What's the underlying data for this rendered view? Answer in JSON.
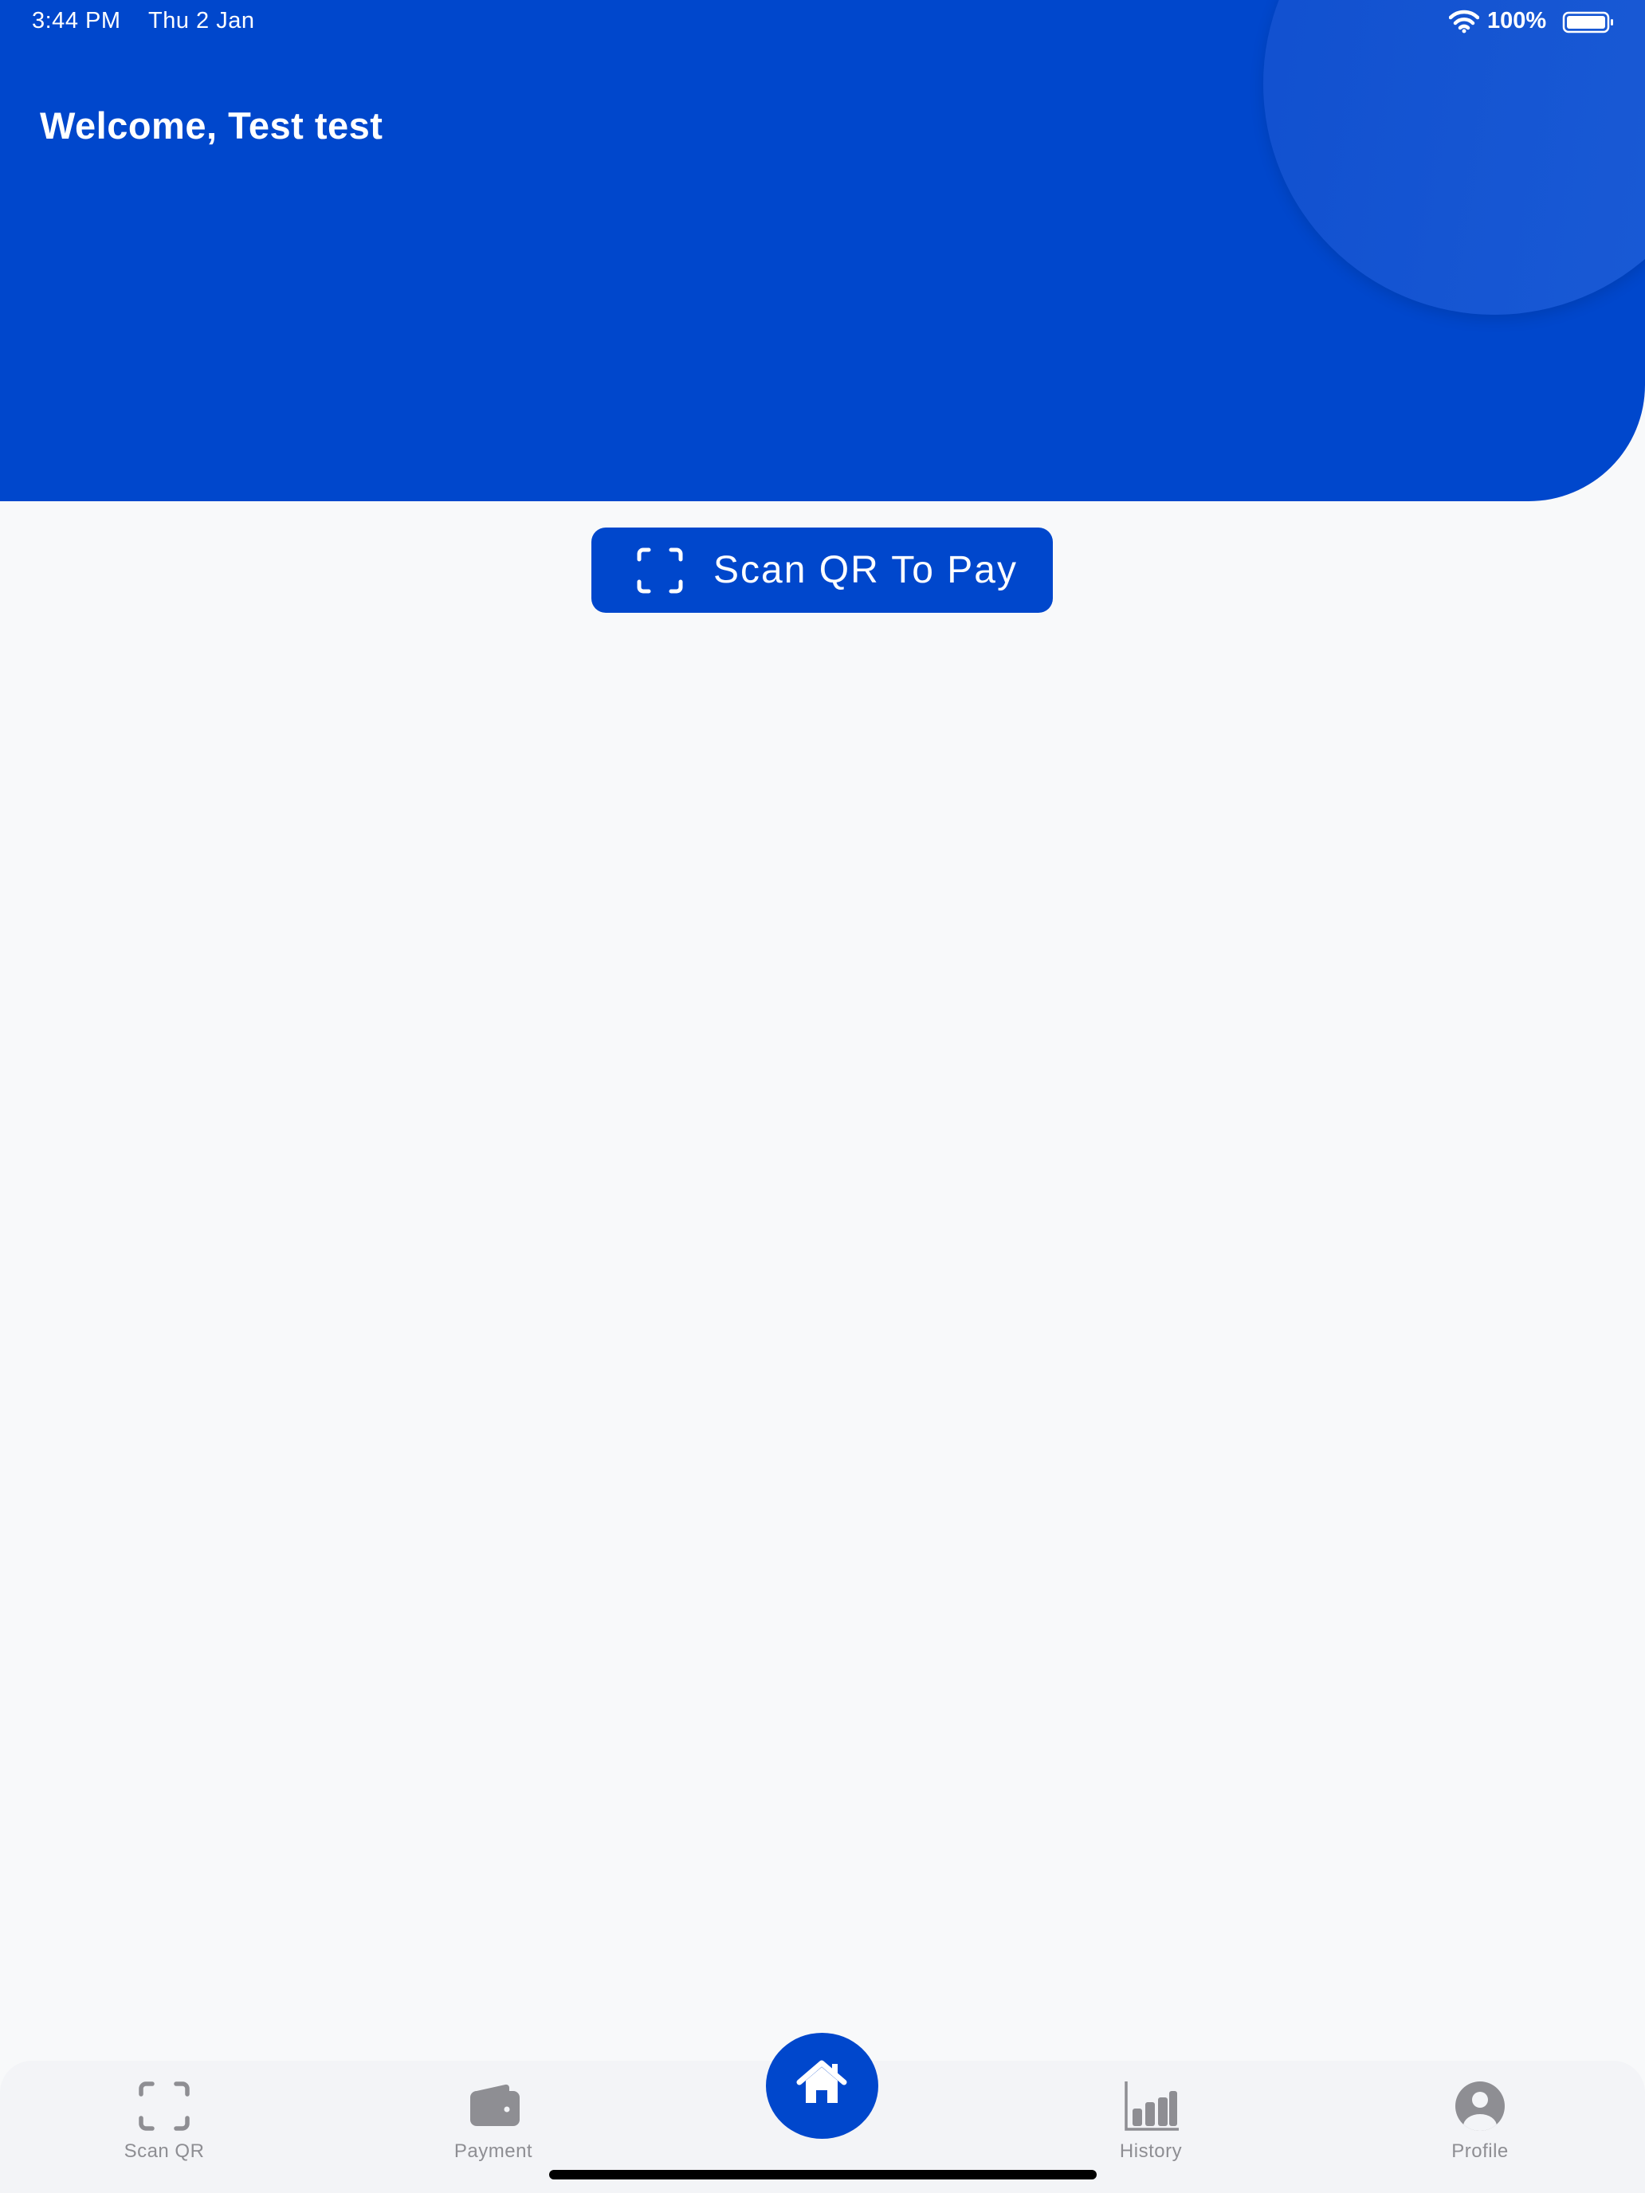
{
  "status_bar": {
    "time": "3:44 PM",
    "date": "Thu 2 Jan",
    "battery_percent": "100%",
    "wifi_icon": "wifi-icon",
    "battery_icon": "battery-icon"
  },
  "header": {
    "welcome_text": "Welcome, Test test"
  },
  "scan_button": {
    "label": "Scan QR To Pay",
    "icon": "scan-frame-icon"
  },
  "tabbar": {
    "items": [
      {
        "label": "Scan QR",
        "icon": "scan-frame-icon"
      },
      {
        "label": "Payment",
        "icon": "wallet-icon"
      },
      {
        "label": "",
        "icon": "home-icon",
        "active": true
      },
      {
        "label": "History",
        "icon": "bar-chart-icon"
      },
      {
        "label": "Profile",
        "icon": "user-circle-icon"
      }
    ]
  },
  "colors": {
    "primary": "#0047cc",
    "background": "#f8f9fa",
    "tab_inactive": "#8e8e93"
  }
}
